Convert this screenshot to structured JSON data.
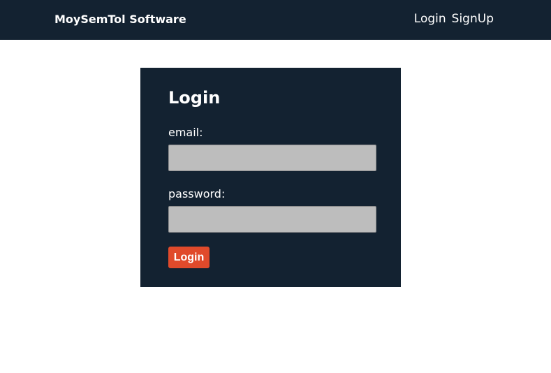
{
  "header": {
    "brand": "MoySemTol Software",
    "nav": [
      {
        "label": "Login"
      },
      {
        "label": "SignUp"
      }
    ]
  },
  "login_form": {
    "title": "Login",
    "email_label": "email:",
    "email_value": "",
    "password_label": "password:",
    "password_value": "",
    "submit_label": "Login"
  },
  "colors": {
    "navbar": "#132231",
    "card": "#132231",
    "input_bg": "#bdbdbd",
    "button": "#e04a2b"
  }
}
